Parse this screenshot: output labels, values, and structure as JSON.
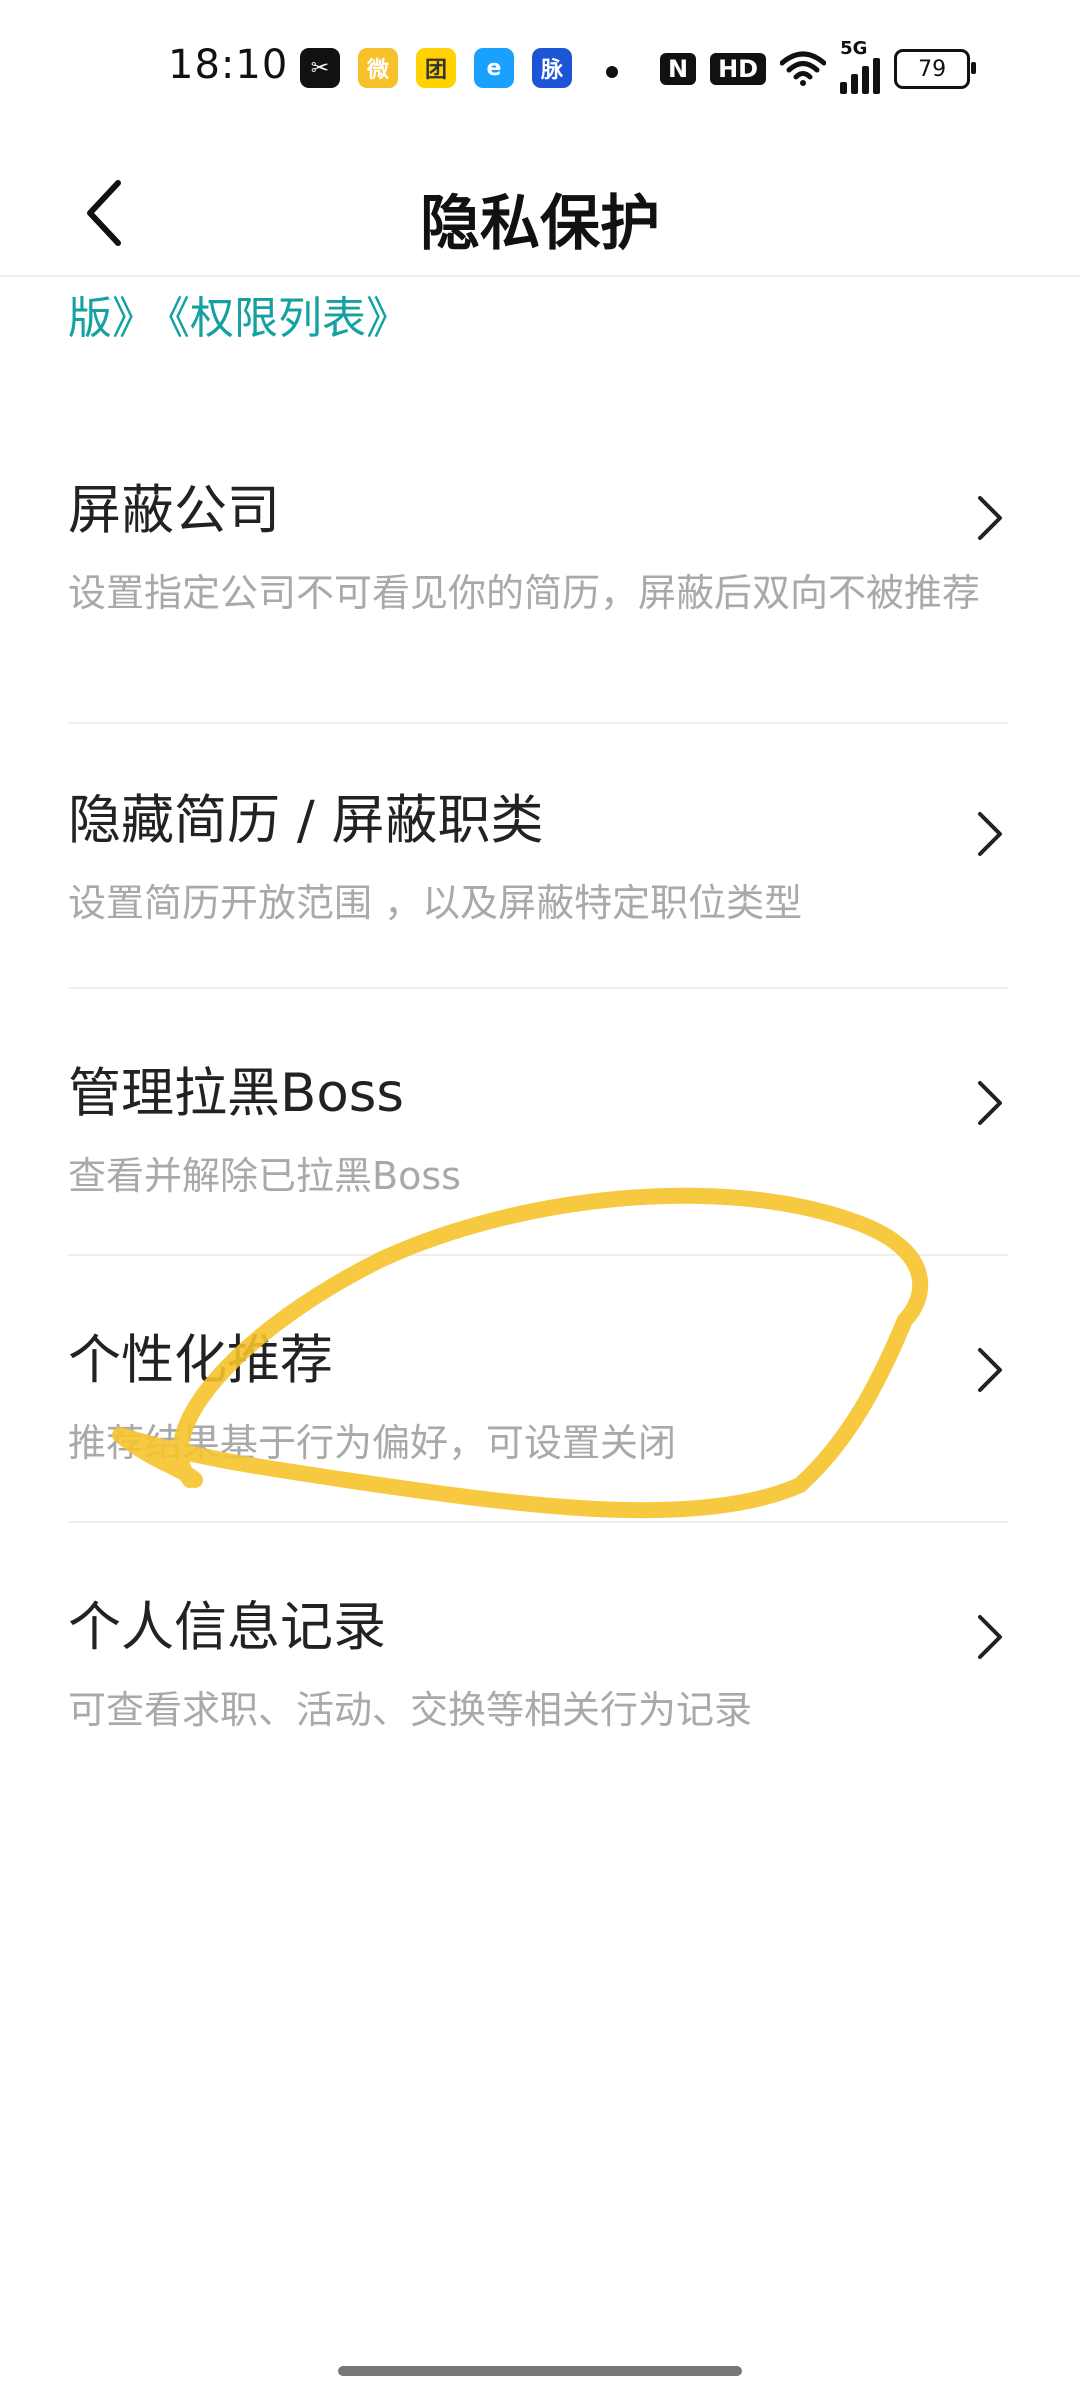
{
  "status_bar": {
    "time": "18:10",
    "apps": [
      {
        "name": "capcut-icon",
        "bg": "#111111",
        "glyph": "✂"
      },
      {
        "name": "weibo-icon",
        "bg": "#f7c12b",
        "glyph": "微"
      },
      {
        "name": "meituan-icon",
        "bg": "#ffd200",
        "glyph": "团"
      },
      {
        "name": "ele-icon",
        "bg": "#1aa0ff",
        "glyph": "e"
      },
      {
        "name": "maimai-icon",
        "bg": "#1c55d6",
        "glyph": "脉"
      }
    ],
    "nfc_label": "N",
    "hd_label": "HD",
    "network_label": "5G",
    "battery_level": "79"
  },
  "header": {
    "title": "隐私保护"
  },
  "links": {
    "prev_text": "版》",
    "permission_list": "《权限列表》"
  },
  "settings": [
    {
      "title": "屏蔽公司",
      "desc": "设置指定公司不可看见你的简历，屏蔽后双向不被推荐"
    },
    {
      "title": "隐藏简历 / 屏蔽职类",
      "desc": "设置简历开放范围 ，以及屏蔽特定职位类型"
    },
    {
      "title": "管理拉黑Boss",
      "desc": "查看并解除已拉黑Boss"
    },
    {
      "title": "个性化推荐",
      "desc": "推荐结果基于行为偏好，可设置关闭"
    },
    {
      "title": "个人信息记录",
      "desc": "可查看求职、活动、交换等相关行为记录"
    }
  ],
  "colors": {
    "accent": "#15a1a1",
    "highlight": "#f5c32c"
  }
}
